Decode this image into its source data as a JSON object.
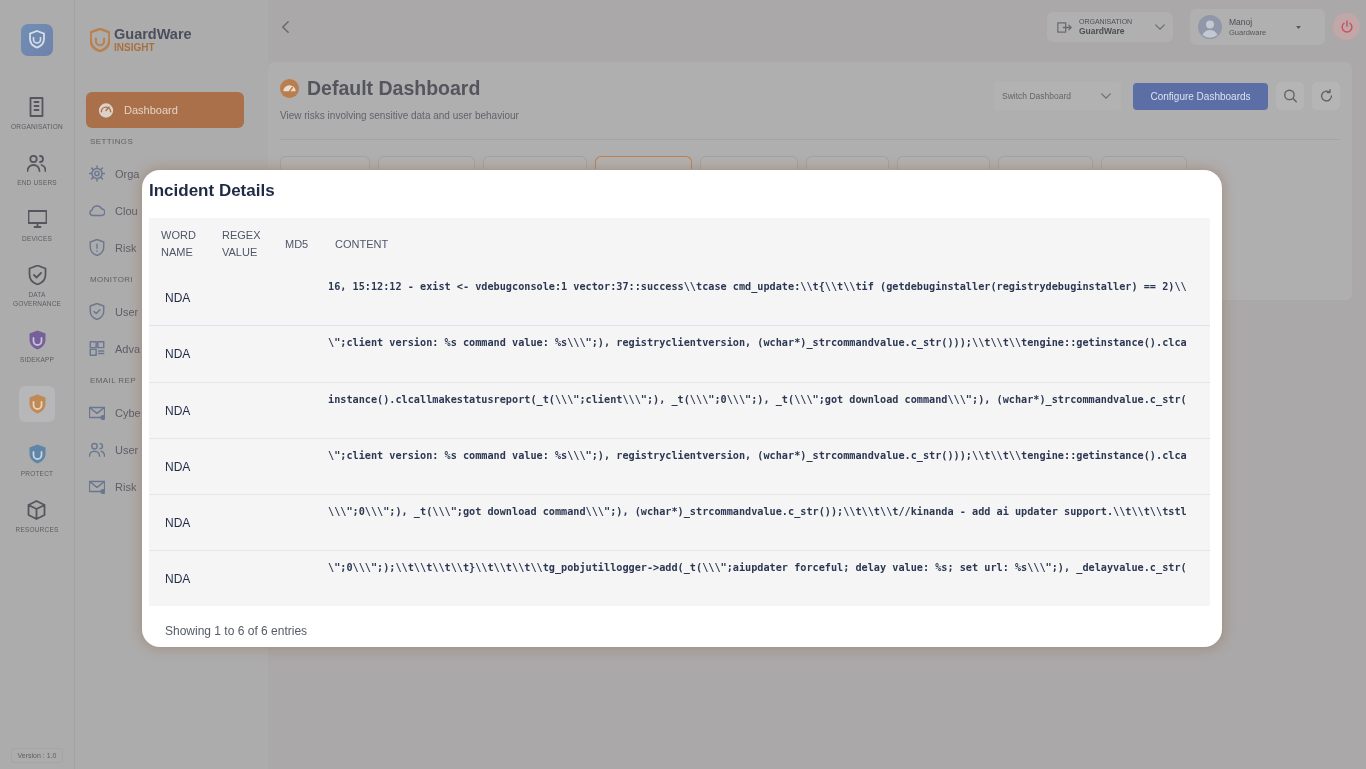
{
  "rail": {
    "items": [
      {
        "label": "ORGANISATION",
        "selected": false
      },
      {
        "label": "END USERS",
        "selected": false
      },
      {
        "label": "DEVICES",
        "selected": false
      },
      {
        "label": "DATA GOVERNANCE",
        "selected": false
      },
      {
        "label": "SIDEKAPP",
        "selected": false
      },
      {
        "selected": true
      },
      {
        "label": "PROTECT",
        "selected": false
      },
      {
        "label": "RESOURCES",
        "selected": false
      }
    ],
    "version": "Version : 1.0"
  },
  "sidebar": {
    "brand": "GuardWare",
    "product": "INSIGHT",
    "sections": [
      {
        "items": [
          {
            "label": "Dashboard",
            "selected": true
          }
        ]
      },
      {
        "title": "SETTINGS",
        "items": [
          {
            "label": "Orga",
            "selected": false
          },
          {
            "label": "Clou",
            "selected": false
          },
          {
            "label": "Risk",
            "selected": false
          }
        ]
      },
      {
        "title": "MONITORI",
        "items": [
          {
            "label": "User",
            "selected": false
          },
          {
            "label": "Adva",
            "selected": false
          }
        ]
      },
      {
        "title": "EMAIL REP",
        "items": [
          {
            "label": "Cybe",
            "selected": false
          },
          {
            "label": "User",
            "selected": false
          },
          {
            "label": "Risk",
            "selected": false
          }
        ]
      }
    ]
  },
  "topbar": {
    "organisation": {
      "label": "ORGANISATION",
      "value": "GuardWare"
    },
    "user": {
      "name": "Manoj",
      "organisation": "Guardware"
    }
  },
  "dashboard": {
    "title": "Default Dashboard",
    "subtitle": "View risks involving sensitive data and user behaviour",
    "switch_dropdown": "Switch Dashboard",
    "configure_button": "Configure Dashboards",
    "tabs": [
      {
        "selected": false
      },
      {
        "selected": false
      },
      {
        "selected": false
      },
      {
        "selected": true
      },
      {
        "selected": false
      },
      {
        "selected": false
      },
      {
        "selected": false
      },
      {
        "selected": false
      },
      {
        "selected": false
      }
    ]
  },
  "modal": {
    "title": "Incident Details",
    "columns": [
      "WORD NAME",
      "REGEX VALUE",
      "MD5",
      "CONTENT"
    ],
    "rows": [
      {
        "word_name": "NDA",
        "content": "16, 15:12:12 - exist <- vdebugconsole:1 vector:37::success\\\\tcase cmd_update:\\\\t{\\\\t\\\\tif (getdebuginstaller(registrydebuginstaller) == 2)\\\\"
      },
      {
        "word_name": "NDA",
        "content": "\\\";client version: %s command value: %s\\\\\\\";), registryclientversion, (wchar*)_strcommandvalue.c_str()));\\\\t\\\\t\\\\tengine::getinstance().clca"
      },
      {
        "word_name": "NDA",
        "content": "instance().clcallmakestatusreport(_t(\\\\\\\";client\\\\\\\";), _t(\\\\\\\";0\\\\\\\";), _t(\\\\\\\";got download command\\\\\\\";), (wchar*)_strcommandvalue.c_str("
      },
      {
        "word_name": "NDA",
        "content": "\\\";client version: %s command value: %s\\\\\\\";), registryclientversion, (wchar*)_strcommandvalue.c_str()));\\\\t\\\\t\\\\tengine::getinstance().clca"
      },
      {
        "word_name": "NDA",
        "content": "\\\\\\\";0\\\\\\\";), _t(\\\\\\\";got download command\\\\\\\";), (wchar*)_strcommandvalue.c_str());\\\\t\\\\t\\\\t//kinanda - add ai updater support.\\\\t\\\\t\\\\tstl"
      },
      {
        "word_name": "NDA",
        "content": "\\\";0\\\\\\\";);\\\\t\\\\t\\\\t\\\\t}\\\\t\\\\t\\\\t\\\\tg_pobjutillogger->add(_t(\\\\\\\";aiupdater forceful; delay value: %s; set url: %s\\\\\\\";), _delayvalue.c_str("
      }
    ],
    "footer": "Showing 1 to 6 of 6 entries"
  }
}
